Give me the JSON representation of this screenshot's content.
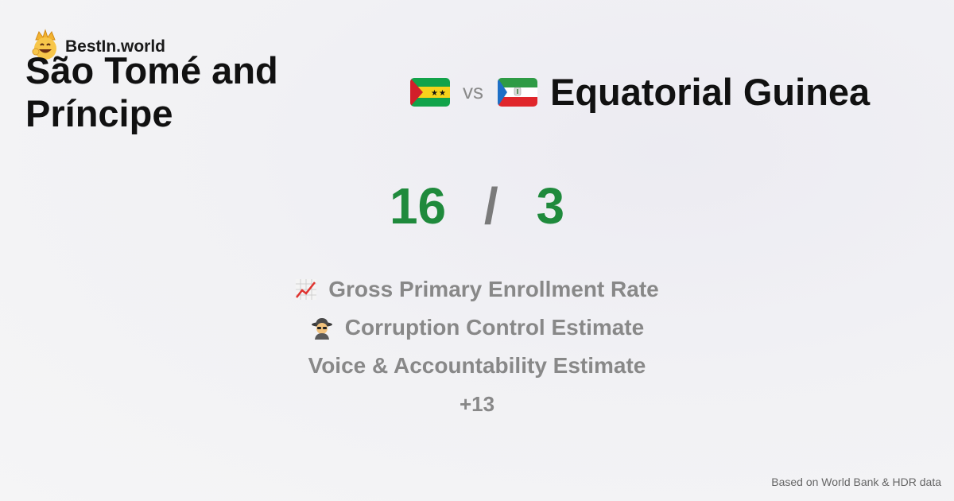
{
  "brand": {
    "name": "BestIn.world",
    "icon": "crown-smiley-icon"
  },
  "comparison": {
    "left_country": "São Tomé and Príncipe",
    "left_flag": "sao-tome-flag-icon",
    "vs_label": "vs",
    "right_flag": "equatorial-guinea-flag-icon",
    "right_country": "Equatorial Guinea"
  },
  "score": {
    "left": "16",
    "separator": "/",
    "right": "3",
    "color": "#1f8a3c"
  },
  "metrics": [
    {
      "icon": "chart-increasing-icon",
      "label": "Gross Primary Enrollment Rate"
    },
    {
      "icon": "spy-icon",
      "label": "Corruption Control Estimate"
    },
    {
      "icon": "",
      "label": "Voice & Accountability Estimate"
    }
  ],
  "more_label": "+13",
  "footer": "Based on World Bank & HDR data"
}
